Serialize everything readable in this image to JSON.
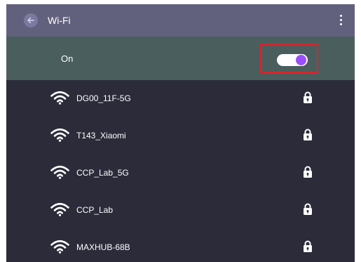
{
  "appbar": {
    "title": "Wi-Fi",
    "back_icon": "arrow-left-icon",
    "menu_icon": "more-vertical-icon"
  },
  "wifi_toggle": {
    "label": "On",
    "state": true
  },
  "networks": [
    {
      "name": "DG00_11F-5G",
      "secured": true
    },
    {
      "name": "T143_Xiaomi",
      "secured": true
    },
    {
      "name": "CCP_Lab_5G",
      "secured": true
    },
    {
      "name": "CCP_Lab",
      "secured": true
    },
    {
      "name": "MAXHUB-68B",
      "secured": true
    }
  ],
  "colors": {
    "appbar": "#62617d",
    "toggle_row": "#4b5e5e",
    "list_bg": "#2b2b3a",
    "switch_knob": "#9b4dff",
    "highlight_border": "#e0202a"
  }
}
